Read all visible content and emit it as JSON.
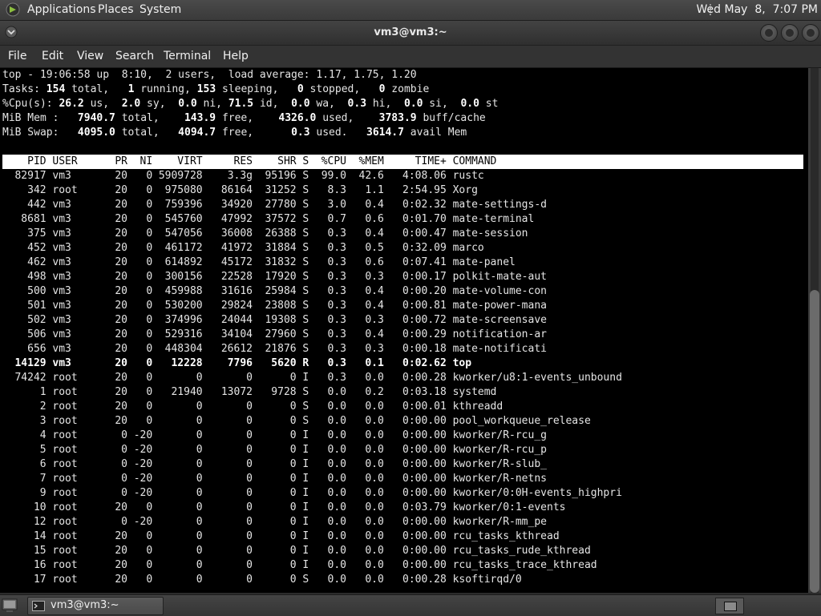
{
  "top_panel": {
    "menus": [
      "Applications",
      "Places",
      "System"
    ],
    "clock": "Wed May  8,  7:07 PM"
  },
  "window": {
    "title": "vm3@vm3:~"
  },
  "menubar": {
    "items": [
      "File",
      "Edit",
      "View",
      "Search",
      "Terminal",
      "Help"
    ]
  },
  "top_output": {
    "summary": [
      [
        {
          "t": "top - 19:06:58 up  8:10,  2 users,  load average: 1.17, 1.75, 1.20",
          "b": false
        }
      ],
      [
        {
          "t": "Tasks: ",
          "b": false
        },
        {
          "t": "154",
          "b": true
        },
        {
          "t": " total,   ",
          "b": false
        },
        {
          "t": "1",
          "b": true
        },
        {
          "t": " running, ",
          "b": false
        },
        {
          "t": "153",
          "b": true
        },
        {
          "t": " sleeping,   ",
          "b": false
        },
        {
          "t": "0",
          "b": true
        },
        {
          "t": " stopped,   ",
          "b": false
        },
        {
          "t": "0",
          "b": true
        },
        {
          "t": " zombie",
          "b": false
        }
      ],
      [
        {
          "t": "%Cpu(s): ",
          "b": false
        },
        {
          "t": "26.2",
          "b": true
        },
        {
          "t": " us,  ",
          "b": false
        },
        {
          "t": "2.0",
          "b": true
        },
        {
          "t": " sy,  ",
          "b": false
        },
        {
          "t": "0.0",
          "b": true
        },
        {
          "t": " ni, ",
          "b": false
        },
        {
          "t": "71.5",
          "b": true
        },
        {
          "t": " id,  ",
          "b": false
        },
        {
          "t": "0.0",
          "b": true
        },
        {
          "t": " wa,  ",
          "b": false
        },
        {
          "t": "0.3",
          "b": true
        },
        {
          "t": " hi,  ",
          "b": false
        },
        {
          "t": "0.0",
          "b": true
        },
        {
          "t": " si,  ",
          "b": false
        },
        {
          "t": "0.0",
          "b": true
        },
        {
          "t": " st",
          "b": false
        }
      ],
      [
        {
          "t": "MiB Mem :   ",
          "b": false
        },
        {
          "t": "7940.7",
          "b": true
        },
        {
          "t": " total,    ",
          "b": false
        },
        {
          "t": "143.9",
          "b": true
        },
        {
          "t": " free,    ",
          "b": false
        },
        {
          "t": "4326.0",
          "b": true
        },
        {
          "t": " used,    ",
          "b": false
        },
        {
          "t": "3783.9",
          "b": true
        },
        {
          "t": " buff/cache",
          "b": false
        }
      ],
      [
        {
          "t": "MiB Swap:   ",
          "b": false
        },
        {
          "t": "4095.0",
          "b": true
        },
        {
          "t": " total,   ",
          "b": false
        },
        {
          "t": "4094.7",
          "b": true
        },
        {
          "t": " free,      ",
          "b": false
        },
        {
          "t": "0.3",
          "b": true
        },
        {
          "t": " used.   ",
          "b": false
        },
        {
          "t": "3614.7",
          "b": true
        },
        {
          "t": " avail Mem",
          "b": false
        }
      ]
    ],
    "columns": [
      "PID",
      "USER",
      "PR",
      "NI",
      "VIRT",
      "RES",
      "SHR",
      "S",
      "%CPU",
      "%MEM",
      "TIME+",
      "COMMAND"
    ],
    "rows": [
      [
        "82917",
        "vm3",
        "20",
        "0",
        "5909728",
        "3.3g",
        "95196",
        "S",
        "99.0",
        "42.6",
        "4:08.06",
        "rustc"
      ],
      [
        "342",
        "root",
        "20",
        "0",
        "975080",
        "86164",
        "31252",
        "S",
        "8.3",
        "1.1",
        "2:54.95",
        "Xorg"
      ],
      [
        "442",
        "vm3",
        "20",
        "0",
        "759396",
        "34920",
        "27780",
        "S",
        "3.0",
        "0.4",
        "0:02.32",
        "mate-settings-d"
      ],
      [
        "8681",
        "vm3",
        "20",
        "0",
        "545760",
        "47992",
        "37572",
        "S",
        "0.7",
        "0.6",
        "0:01.70",
        "mate-terminal"
      ],
      [
        "375",
        "vm3",
        "20",
        "0",
        "547056",
        "36008",
        "26388",
        "S",
        "0.3",
        "0.4",
        "0:00.47",
        "mate-session"
      ],
      [
        "452",
        "vm3",
        "20",
        "0",
        "461172",
        "41972",
        "31884",
        "S",
        "0.3",
        "0.5",
        "0:32.09",
        "marco"
      ],
      [
        "462",
        "vm3",
        "20",
        "0",
        "614892",
        "45172",
        "31832",
        "S",
        "0.3",
        "0.6",
        "0:07.41",
        "mate-panel"
      ],
      [
        "498",
        "vm3",
        "20",
        "0",
        "300156",
        "22528",
        "17920",
        "S",
        "0.3",
        "0.3",
        "0:00.17",
        "polkit-mate-aut"
      ],
      [
        "500",
        "vm3",
        "20",
        "0",
        "459988",
        "31616",
        "25984",
        "S",
        "0.3",
        "0.4",
        "0:00.20",
        "mate-volume-con"
      ],
      [
        "501",
        "vm3",
        "20",
        "0",
        "530200",
        "29824",
        "23808",
        "S",
        "0.3",
        "0.4",
        "0:00.81",
        "mate-power-mana"
      ],
      [
        "502",
        "vm3",
        "20",
        "0",
        "374996",
        "24044",
        "19308",
        "S",
        "0.3",
        "0.3",
        "0:00.72",
        "mate-screensave"
      ],
      [
        "506",
        "vm3",
        "20",
        "0",
        "529316",
        "34104",
        "27960",
        "S",
        "0.3",
        "0.4",
        "0:00.29",
        "notification-ar"
      ],
      [
        "656",
        "vm3",
        "20",
        "0",
        "448304",
        "26612",
        "21876",
        "S",
        "0.3",
        "0.3",
        "0:00.18",
        "mate-notificati"
      ],
      [
        "14129",
        "vm3",
        "20",
        "0",
        "12228",
        "7796",
        "5620",
        "R",
        "0.3",
        "0.1",
        "0:02.62",
        "top"
      ],
      [
        "74242",
        "root",
        "20",
        "0",
        "0",
        "0",
        "0",
        "I",
        "0.3",
        "0.0",
        "0:00.28",
        "kworker/u8:1-events_unbound"
      ],
      [
        "1",
        "root",
        "20",
        "0",
        "21940",
        "13072",
        "9728",
        "S",
        "0.0",
        "0.2",
        "0:03.18",
        "systemd"
      ],
      [
        "2",
        "root",
        "20",
        "0",
        "0",
        "0",
        "0",
        "S",
        "0.0",
        "0.0",
        "0:00.01",
        "kthreadd"
      ],
      [
        "3",
        "root",
        "20",
        "0",
        "0",
        "0",
        "0",
        "S",
        "0.0",
        "0.0",
        "0:00.00",
        "pool_workqueue_release"
      ],
      [
        "4",
        "root",
        "0",
        "-20",
        "0",
        "0",
        "0",
        "I",
        "0.0",
        "0.0",
        "0:00.00",
        "kworker/R-rcu_g"
      ],
      [
        "5",
        "root",
        "0",
        "-20",
        "0",
        "0",
        "0",
        "I",
        "0.0",
        "0.0",
        "0:00.00",
        "kworker/R-rcu_p"
      ],
      [
        "6",
        "root",
        "0",
        "-20",
        "0",
        "0",
        "0",
        "I",
        "0.0",
        "0.0",
        "0:00.00",
        "kworker/R-slub_"
      ],
      [
        "7",
        "root",
        "0",
        "-20",
        "0",
        "0",
        "0",
        "I",
        "0.0",
        "0.0",
        "0:00.00",
        "kworker/R-netns"
      ],
      [
        "9",
        "root",
        "0",
        "-20",
        "0",
        "0",
        "0",
        "I",
        "0.0",
        "0.0",
        "0:00.00",
        "kworker/0:0H-events_highpri"
      ],
      [
        "10",
        "root",
        "20",
        "0",
        "0",
        "0",
        "0",
        "I",
        "0.0",
        "0.0",
        "0:03.79",
        "kworker/0:1-events"
      ],
      [
        "12",
        "root",
        "0",
        "-20",
        "0",
        "0",
        "0",
        "I",
        "0.0",
        "0.0",
        "0:00.00",
        "kworker/R-mm_pe"
      ],
      [
        "14",
        "root",
        "20",
        "0",
        "0",
        "0",
        "0",
        "I",
        "0.0",
        "0.0",
        "0:00.00",
        "rcu_tasks_kthread"
      ],
      [
        "15",
        "root",
        "20",
        "0",
        "0",
        "0",
        "0",
        "I",
        "0.0",
        "0.0",
        "0:00.00",
        "rcu_tasks_rude_kthread"
      ],
      [
        "16",
        "root",
        "20",
        "0",
        "0",
        "0",
        "0",
        "I",
        "0.0",
        "0.0",
        "0:00.00",
        "rcu_tasks_trace_kthread"
      ],
      [
        "17",
        "root",
        "20",
        "0",
        "0",
        "0",
        "0",
        "S",
        "0.0",
        "0.0",
        "0:00.28",
        "ksoftirqd/0"
      ]
    ],
    "highlight_pid": "14129"
  },
  "bottom_panel": {
    "task_label": "vm3@vm3:~"
  },
  "colors": {
    "terminal_bg": "#000000",
    "terminal_fg": "#e5e5e5",
    "header_bg": "#ffffff",
    "panel_bg": "#3a3a3a"
  }
}
